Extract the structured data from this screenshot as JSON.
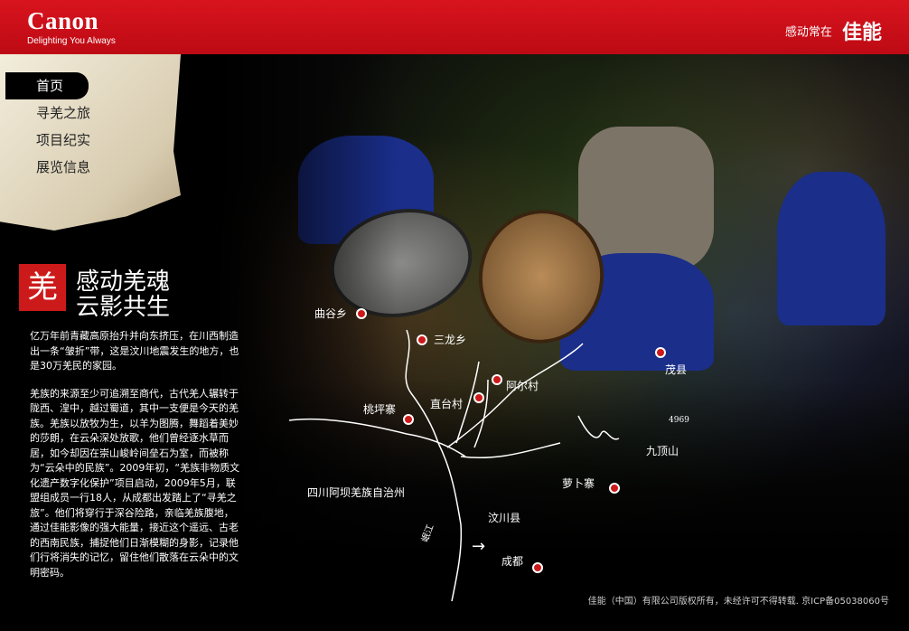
{
  "header": {
    "brand": "Canon",
    "tagline": "Delighting You Always",
    "slogan_small": "感动常在",
    "slogan_big": "佳能"
  },
  "nav": {
    "items": [
      {
        "label": "首页"
      },
      {
        "label": "寻羌之旅"
      },
      {
        "label": "项目纪实"
      },
      {
        "label": "展览信息"
      }
    ],
    "active_index": 0
  },
  "feature": {
    "badge_glyph": "羌",
    "title_line1": "感动羌魂",
    "title_line2": "云影共生"
  },
  "body": {
    "paragraph1": "亿万年前青藏高原抬升并向东挤压，在川西制造出一条“皱折”带，这是汶川地震发生的地方，也是30万羌民的家园。",
    "paragraph2": "羌族的来源至少可追溯至商代，古代羌人辗转于陇西、湟中，越过蜀道，其中一支便是今天的羌族。羌族以放牧为生，以羊为图腾，舞蹈着美妙的莎朗，在云朵深处放歌，他们曾经逐水草而居，如今却因在崇山峻岭间垒石为室，而被称为“云朵中的民族”。2009年初，“羌族非物质文化遗产数字化保护”项目启动，2009年5月，联盟组成员一行18人，从成都出发踏上了“寻羌之旅”。他们将穿行于深谷险路，亲临羌族腹地，通过佳能影像的强大能量，接近这个遥远、古老的西南民族，捕捉他们日渐模糊的身影，记录他们行将消失的记忆，留住他们散落在云朵中的文明密码。"
  },
  "map": {
    "places": {
      "qugu": "曲谷乡",
      "sanlong": "三龙乡",
      "aer": "阿尔村",
      "zhitai": "直台村",
      "maoxian": "茂县",
      "taoping": "桃坪寨",
      "jiuding": "九顶山",
      "jiuding_height": "4969",
      "luobu": "萝卜寨",
      "region": "四川阿坝羌族自治州",
      "wenchuan": "汶川县",
      "river": "岷江",
      "chengdu": "成都"
    },
    "colors": {
      "dot": "#cc1a1a",
      "line": "#ffffff"
    }
  },
  "footer": {
    "copyright": "佳能（中国）有限公司版权所有，未经许可不得转载. 京ICP备05038060号"
  },
  "colors": {
    "brand_red": "#cc0a14",
    "scroll": "#e6dcc4"
  }
}
